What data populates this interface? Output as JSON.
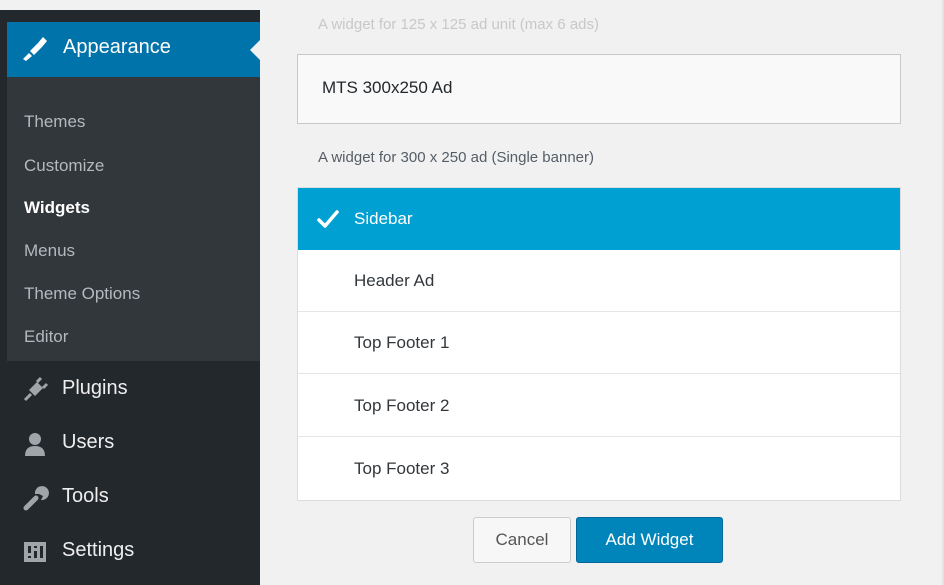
{
  "admin_menu": {
    "current": {
      "label": "Appearance",
      "icon": "paintbrush-icon"
    },
    "submenu": [
      {
        "label": "Themes",
        "active": false
      },
      {
        "label": "Customize",
        "active": false
      },
      {
        "label": "Widgets",
        "active": true
      },
      {
        "label": "Menus",
        "active": false
      },
      {
        "label": "Theme Options",
        "active": false
      },
      {
        "label": "Editor",
        "active": false
      }
    ],
    "items": [
      {
        "label": "Plugins",
        "icon": "plug-icon"
      },
      {
        "label": "Users",
        "icon": "user-icon"
      },
      {
        "label": "Tools",
        "icon": "wrench-icon"
      },
      {
        "label": "Settings",
        "icon": "sliders-icon"
      }
    ]
  },
  "widgets": {
    "prev_description": "A widget for 125 x 125 ad unit (max 6 ads)",
    "selected_widget": {
      "title": "MTS 300x250 Ad",
      "description": "A widget for 300 x 250 ad (Single banner)"
    },
    "areas": [
      {
        "label": "Sidebar",
        "selected": true
      },
      {
        "label": "Header Ad",
        "selected": false
      },
      {
        "label": "Top Footer 1",
        "selected": false
      },
      {
        "label": "Top Footer 2",
        "selected": false
      },
      {
        "label": "Top Footer 3",
        "selected": false
      }
    ],
    "cancel_label": "Cancel",
    "add_label": "Add Widget"
  },
  "colors": {
    "sidebar_bg": "#23282d",
    "submenu_bg": "#32373c",
    "current_bg": "#0073aa",
    "selected_area_bg": "#00a0d2",
    "primary_button": "#0085ba"
  }
}
